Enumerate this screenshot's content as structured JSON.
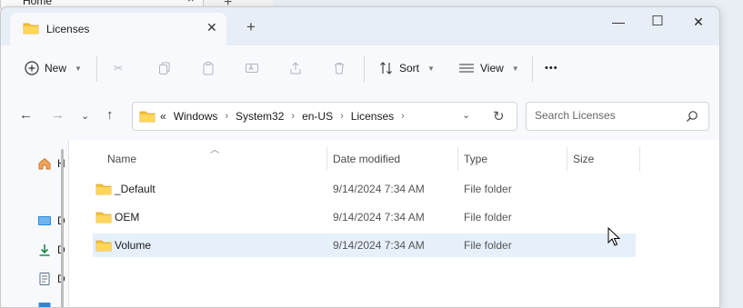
{
  "background_window": {
    "tab_title": "Home",
    "close": "×",
    "new_tab": "+"
  },
  "window": {
    "tab_title": "Licenses",
    "tab_close": "✕",
    "new_tab": "+",
    "controls": {
      "minimize": "—",
      "maximize": "☐",
      "close": "✕"
    }
  },
  "toolbar": {
    "new_label": "New",
    "sort_label": "Sort",
    "view_label": "View",
    "more_label": "•••"
  },
  "address": {
    "overflow": "«",
    "crumbs": [
      "Windows",
      "System32",
      "en-US",
      "Licenses"
    ],
    "search_placeholder": "Search Licenses"
  },
  "navigation_pane": {
    "items": [
      {
        "icon": "home-icon",
        "label": "H"
      },
      {
        "icon": "desktop-icon",
        "label": "D"
      },
      {
        "icon": "downloads-icon",
        "label": "D"
      },
      {
        "icon": "documents-icon",
        "label": "D"
      },
      {
        "icon": "pictures-icon",
        "label": ""
      }
    ]
  },
  "columns": {
    "name": "Name",
    "date": "Date modified",
    "type": "Type",
    "size": "Size"
  },
  "files": [
    {
      "name": "_Default",
      "date": "9/14/2024 7:34 AM",
      "type": "File folder",
      "size": ""
    },
    {
      "name": "OEM",
      "date": "9/14/2024 7:34 AM",
      "type": "File folder",
      "size": ""
    },
    {
      "name": "Volume",
      "date": "9/14/2024 7:34 AM",
      "type": "File folder",
      "size": ""
    }
  ],
  "colors": {
    "folder": "#f5c33b",
    "selected_row": "#e6f0fb",
    "accent": "#0067c0"
  }
}
